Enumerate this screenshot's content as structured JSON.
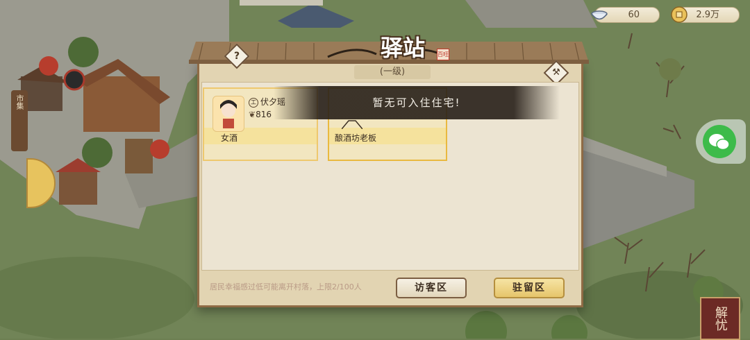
{
  "resources": {
    "bowl": {
      "icon": "bowl-icon",
      "value": "60"
    },
    "coin": {
      "icon": "coin-icon",
      "value": "2.9万"
    }
  },
  "panel": {
    "title": "驿站",
    "seal": "百旺",
    "level": "(一级)",
    "help_icon": "question-icon",
    "build_icon": "hammer-icon"
  },
  "residents": [
    {
      "name": "伏夕瑶",
      "attr_badge": "工",
      "power": "816",
      "tag": "女酒"
    },
    {
      "name": "",
      "attr_badge": "",
      "power": "",
      "tag": "酿酒坊老板"
    }
  ],
  "toast": "暂无可入住住宅!",
  "footer": {
    "note": "居民幸福感过低可能离开村落，上限2/100人",
    "visitor_label": "访客区",
    "resident_label": "驻留区"
  },
  "side": {
    "map_marker": "市集",
    "jieyou": "解忧"
  },
  "colors": {
    "panel_bg": "#e2d4b2",
    "frame": "#8f6b45",
    "card_border": "#eec86e",
    "grass": "#6d7f52"
  }
}
